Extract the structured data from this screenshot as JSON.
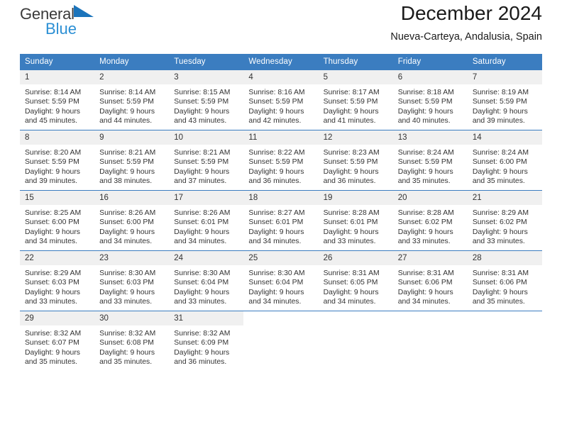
{
  "brand": {
    "name_line1": "General",
    "name_line2": "Blue",
    "triangle_color": "#1b74bb",
    "blue_text_color": "#2b8fd4"
  },
  "header": {
    "title": "December 2024",
    "subtitle": "Nueva-Carteya, Andalusia, Spain"
  },
  "theme": {
    "header_row_bg": "#3b7dc0",
    "header_row_text": "#ffffff",
    "daynum_bg": "#f0f0f0",
    "cell_bg": "#ffffff",
    "text": "#333333"
  },
  "calendar": {
    "weekday_headers": [
      "Sunday",
      "Monday",
      "Tuesday",
      "Wednesday",
      "Thursday",
      "Friday",
      "Saturday"
    ],
    "weeks": [
      [
        {
          "day": "1",
          "sunrise": "Sunrise: 8:14 AM",
          "sunset": "Sunset: 5:59 PM",
          "daylight1": "Daylight: 9 hours",
          "daylight2": "and 45 minutes."
        },
        {
          "day": "2",
          "sunrise": "Sunrise: 8:14 AM",
          "sunset": "Sunset: 5:59 PM",
          "daylight1": "Daylight: 9 hours",
          "daylight2": "and 44 minutes."
        },
        {
          "day": "3",
          "sunrise": "Sunrise: 8:15 AM",
          "sunset": "Sunset: 5:59 PM",
          "daylight1": "Daylight: 9 hours",
          "daylight2": "and 43 minutes."
        },
        {
          "day": "4",
          "sunrise": "Sunrise: 8:16 AM",
          "sunset": "Sunset: 5:59 PM",
          "daylight1": "Daylight: 9 hours",
          "daylight2": "and 42 minutes."
        },
        {
          "day": "5",
          "sunrise": "Sunrise: 8:17 AM",
          "sunset": "Sunset: 5:59 PM",
          "daylight1": "Daylight: 9 hours",
          "daylight2": "and 41 minutes."
        },
        {
          "day": "6",
          "sunrise": "Sunrise: 8:18 AM",
          "sunset": "Sunset: 5:59 PM",
          "daylight1": "Daylight: 9 hours",
          "daylight2": "and 40 minutes."
        },
        {
          "day": "7",
          "sunrise": "Sunrise: 8:19 AM",
          "sunset": "Sunset: 5:59 PM",
          "daylight1": "Daylight: 9 hours",
          "daylight2": "and 39 minutes."
        }
      ],
      [
        {
          "day": "8",
          "sunrise": "Sunrise: 8:20 AM",
          "sunset": "Sunset: 5:59 PM",
          "daylight1": "Daylight: 9 hours",
          "daylight2": "and 39 minutes."
        },
        {
          "day": "9",
          "sunrise": "Sunrise: 8:21 AM",
          "sunset": "Sunset: 5:59 PM",
          "daylight1": "Daylight: 9 hours",
          "daylight2": "and 38 minutes."
        },
        {
          "day": "10",
          "sunrise": "Sunrise: 8:21 AM",
          "sunset": "Sunset: 5:59 PM",
          "daylight1": "Daylight: 9 hours",
          "daylight2": "and 37 minutes."
        },
        {
          "day": "11",
          "sunrise": "Sunrise: 8:22 AM",
          "sunset": "Sunset: 5:59 PM",
          "daylight1": "Daylight: 9 hours",
          "daylight2": "and 36 minutes."
        },
        {
          "day": "12",
          "sunrise": "Sunrise: 8:23 AM",
          "sunset": "Sunset: 5:59 PM",
          "daylight1": "Daylight: 9 hours",
          "daylight2": "and 36 minutes."
        },
        {
          "day": "13",
          "sunrise": "Sunrise: 8:24 AM",
          "sunset": "Sunset: 5:59 PM",
          "daylight1": "Daylight: 9 hours",
          "daylight2": "and 35 minutes."
        },
        {
          "day": "14",
          "sunrise": "Sunrise: 8:24 AM",
          "sunset": "Sunset: 6:00 PM",
          "daylight1": "Daylight: 9 hours",
          "daylight2": "and 35 minutes."
        }
      ],
      [
        {
          "day": "15",
          "sunrise": "Sunrise: 8:25 AM",
          "sunset": "Sunset: 6:00 PM",
          "daylight1": "Daylight: 9 hours",
          "daylight2": "and 34 minutes."
        },
        {
          "day": "16",
          "sunrise": "Sunrise: 8:26 AM",
          "sunset": "Sunset: 6:00 PM",
          "daylight1": "Daylight: 9 hours",
          "daylight2": "and 34 minutes."
        },
        {
          "day": "17",
          "sunrise": "Sunrise: 8:26 AM",
          "sunset": "Sunset: 6:01 PM",
          "daylight1": "Daylight: 9 hours",
          "daylight2": "and 34 minutes."
        },
        {
          "day": "18",
          "sunrise": "Sunrise: 8:27 AM",
          "sunset": "Sunset: 6:01 PM",
          "daylight1": "Daylight: 9 hours",
          "daylight2": "and 34 minutes."
        },
        {
          "day": "19",
          "sunrise": "Sunrise: 8:28 AM",
          "sunset": "Sunset: 6:01 PM",
          "daylight1": "Daylight: 9 hours",
          "daylight2": "and 33 minutes."
        },
        {
          "day": "20",
          "sunrise": "Sunrise: 8:28 AM",
          "sunset": "Sunset: 6:02 PM",
          "daylight1": "Daylight: 9 hours",
          "daylight2": "and 33 minutes."
        },
        {
          "day": "21",
          "sunrise": "Sunrise: 8:29 AM",
          "sunset": "Sunset: 6:02 PM",
          "daylight1": "Daylight: 9 hours",
          "daylight2": "and 33 minutes."
        }
      ],
      [
        {
          "day": "22",
          "sunrise": "Sunrise: 8:29 AM",
          "sunset": "Sunset: 6:03 PM",
          "daylight1": "Daylight: 9 hours",
          "daylight2": "and 33 minutes."
        },
        {
          "day": "23",
          "sunrise": "Sunrise: 8:30 AM",
          "sunset": "Sunset: 6:03 PM",
          "daylight1": "Daylight: 9 hours",
          "daylight2": "and 33 minutes."
        },
        {
          "day": "24",
          "sunrise": "Sunrise: 8:30 AM",
          "sunset": "Sunset: 6:04 PM",
          "daylight1": "Daylight: 9 hours",
          "daylight2": "and 33 minutes."
        },
        {
          "day": "25",
          "sunrise": "Sunrise: 8:30 AM",
          "sunset": "Sunset: 6:04 PM",
          "daylight1": "Daylight: 9 hours",
          "daylight2": "and 34 minutes."
        },
        {
          "day": "26",
          "sunrise": "Sunrise: 8:31 AM",
          "sunset": "Sunset: 6:05 PM",
          "daylight1": "Daylight: 9 hours",
          "daylight2": "and 34 minutes."
        },
        {
          "day": "27",
          "sunrise": "Sunrise: 8:31 AM",
          "sunset": "Sunset: 6:06 PM",
          "daylight1": "Daylight: 9 hours",
          "daylight2": "and 34 minutes."
        },
        {
          "day": "28",
          "sunrise": "Sunrise: 8:31 AM",
          "sunset": "Sunset: 6:06 PM",
          "daylight1": "Daylight: 9 hours",
          "daylight2": "and 35 minutes."
        }
      ],
      [
        {
          "day": "29",
          "sunrise": "Sunrise: 8:32 AM",
          "sunset": "Sunset: 6:07 PM",
          "daylight1": "Daylight: 9 hours",
          "daylight2": "and 35 minutes."
        },
        {
          "day": "30",
          "sunrise": "Sunrise: 8:32 AM",
          "sunset": "Sunset: 6:08 PM",
          "daylight1": "Daylight: 9 hours",
          "daylight2": "and 35 minutes."
        },
        {
          "day": "31",
          "sunrise": "Sunrise: 8:32 AM",
          "sunset": "Sunset: 6:09 PM",
          "daylight1": "Daylight: 9 hours",
          "daylight2": "and 36 minutes."
        },
        {
          "day": "",
          "sunrise": "",
          "sunset": "",
          "daylight1": "",
          "daylight2": ""
        },
        {
          "day": "",
          "sunrise": "",
          "sunset": "",
          "daylight1": "",
          "daylight2": ""
        },
        {
          "day": "",
          "sunrise": "",
          "sunset": "",
          "daylight1": "",
          "daylight2": ""
        },
        {
          "day": "",
          "sunrise": "",
          "sunset": "",
          "daylight1": "",
          "daylight2": ""
        }
      ]
    ]
  }
}
